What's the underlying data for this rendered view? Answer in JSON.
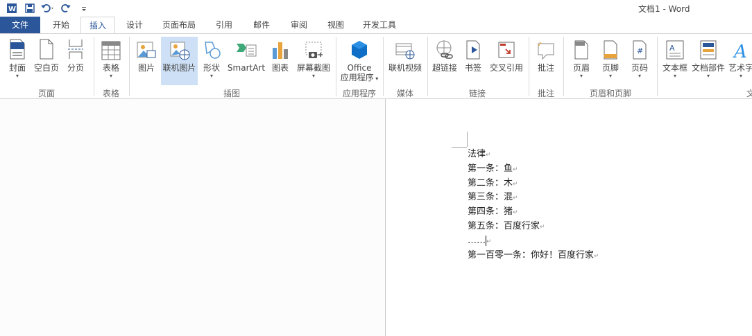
{
  "window": {
    "title": "文档1 - Word"
  },
  "qat": {
    "icons": [
      "word-logo-icon",
      "save-icon",
      "undo-icon",
      "redo-icon",
      "customize-icon"
    ]
  },
  "tabs": [
    "文件",
    "开始",
    "插入",
    "设计",
    "页面布局",
    "引用",
    "邮件",
    "审阅",
    "视图",
    "开发工具"
  ],
  "active_tab": "插入",
  "ribbon": {
    "buttons": {
      "cover": "封面",
      "blank_page": "空白页",
      "page_break": "分页",
      "table": "表格",
      "picture": "图片",
      "online_picture": "联机图片",
      "shapes": "形状",
      "smartart": "SmartArt",
      "chart": "图表",
      "screenshot": "屏幕截图",
      "office_apps_1": "Office",
      "office_apps_2": "应用程序",
      "online_video": "联机视频",
      "hyperlink": "超链接",
      "bookmark": "书签",
      "cross_ref": "交叉引用",
      "comment": "批注",
      "header": "页眉",
      "footer": "页脚",
      "page_number": "页码",
      "textbox": "文本框",
      "quick_parts": "文档部件",
      "wordart": "艺术字"
    },
    "groups": {
      "pages": "页面",
      "tables": "表格",
      "illustrations": "插图",
      "apps": "应用程序",
      "media": "媒体",
      "links": "链接",
      "comments": "批注",
      "header_footer": "页眉和页脚",
      "text_partial": "文"
    }
  },
  "document": {
    "lines": [
      "法律",
      "第一条：鱼",
      "第二条：木",
      "第三条：混",
      "第四条：猪",
      "第五条：百度行家",
      "……",
      "第一百零一条：你好！百度行家"
    ],
    "paragraph_mark": "↵"
  },
  "colors": {
    "file_tab": "#2b579a",
    "accent": "#2b579a",
    "selected_button": "#cde0f5"
  }
}
